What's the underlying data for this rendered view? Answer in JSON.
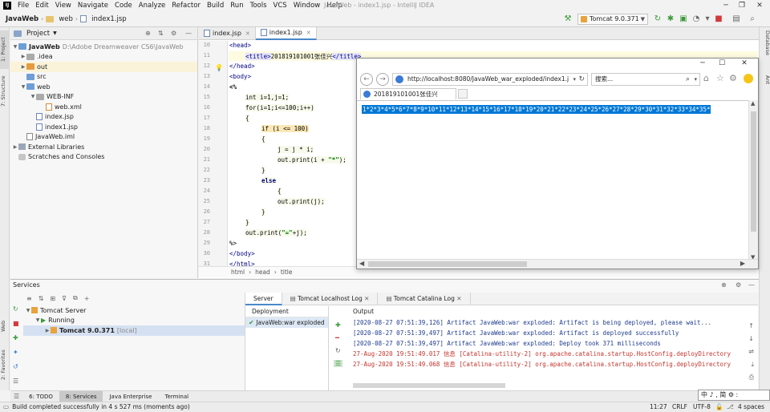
{
  "menubar": {
    "items": [
      "File",
      "Edit",
      "View",
      "Navigate",
      "Code",
      "Analyze",
      "Refactor",
      "Build",
      "Run",
      "Tools",
      "VCS",
      "Window",
      "Help"
    ],
    "window_title": "JavaWeb - index1.jsp - IntelliJ IDEA"
  },
  "navbar": {
    "crumbs": [
      "JavaWeb",
      "web",
      "index1.jsp"
    ],
    "run_config": "Tomcat 9.0.371"
  },
  "left_stripe": {
    "project": "1: Project",
    "structure": "7: Structure",
    "web": "Web",
    "favorites": "2: Favorites"
  },
  "right_stripe": {
    "database": "Database",
    "ant": "Ant"
  },
  "project": {
    "title": "Project",
    "tree": [
      {
        "label": "JavaWeb",
        "path": "D:\\Adobe Dreamweaver CS6\\JavaWeb"
      },
      {
        "label": ".idea"
      },
      {
        "label": "out"
      },
      {
        "label": "src"
      },
      {
        "label": "web"
      },
      {
        "label": "WEB-INF"
      },
      {
        "label": "web.xml"
      },
      {
        "label": "index.jsp"
      },
      {
        "label": "index1.jsp"
      },
      {
        "label": "JavaWeb.iml"
      },
      {
        "label": "External Libraries"
      },
      {
        "label": "Scratches and Consoles"
      }
    ]
  },
  "editor": {
    "tabs": [
      "index.jsp",
      "index1.jsp"
    ],
    "line_numbers": [
      "10",
      "11",
      "12",
      "13",
      "14",
      "15",
      "16",
      "17",
      "18",
      "19",
      "20",
      "21",
      "22",
      "23",
      "24",
      "25",
      "26",
      "27",
      "28",
      "29",
      "30",
      "31"
    ],
    "breadcrumb": [
      "html",
      "head",
      "title"
    ],
    "code": {
      "l10": "<head>",
      "l11_title_open": "<title>",
      "l11_title_text": "201819101001张佳兴",
      "l11_title_close": "</title>",
      "l12": "</head>",
      "l13": "<body>",
      "l14": "<%",
      "l15": "int i=1,j=1;",
      "l16": "for(i=1;i<=100;i++)",
      "l17": "{",
      "l18": "if (i <= 100)",
      "l19": "{",
      "l20": "j = j * i;",
      "l21a": "out.print(i + ",
      "l21b": "\"*\"",
      "l21c": ");",
      "l22": "}",
      "l23": "else",
      "l24": "{",
      "l25": "out.print(j);",
      "l26": "}",
      "l27": "}",
      "l28a": "out.print(",
      "l28b": "\"=\"",
      "l28c": "+j);",
      "l29": "%>",
      "l30": "</body>",
      "l31": "</html>"
    }
  },
  "browser": {
    "url": "http://localhost:8080/JavaWeb_war_exploded/index1.j",
    "search_placeholder": "搜索...",
    "tab_title": "201819101001张佳兴",
    "output": "1*2*3*4*5*6*7*8*9*10*11*12*13*14*15*16*17*18*19*20*21*22*23*24*25*26*27*28*29*30*31*32*33*34*35*"
  },
  "services": {
    "title": "Services",
    "tree": [
      {
        "label": "Tomcat Server"
      },
      {
        "label": "Running"
      },
      {
        "label": "Tomcat 9.0.371",
        "suffix": "[local]"
      }
    ],
    "tabs": [
      "Server",
      "Tomcat Localhost Log",
      "Tomcat Catalina Log"
    ],
    "deployment_header": "Deployment",
    "deployment_item": "JavaWeb:war exploded",
    "output_header": "Output",
    "log": [
      {
        "text": "[2020-08-27 07:51:39,126] Artifact JavaWeb:war exploded: Artifact is being deployed, please wait...",
        "kind": "info"
      },
      {
        "text": "[2020-08-27 07:51:39,497] Artifact JavaWeb:war exploded: Artifact is deployed successfully",
        "kind": "info"
      },
      {
        "text": "[2020-08-27 07:51:39,497] Artifact JavaWeb:war exploded: Deploy took 371 milliseconds",
        "kind": "info"
      },
      {
        "text": "27-Aug-2020 19:51:49.017 信息 [Catalina-utility-2] org.apache.catalina.startup.HostConfig.deployDirectory",
        "kind": "err"
      },
      {
        "text": "27-Aug-2020 19:51:49.068 信息 [Catalina-utility-2] org.apache.catalina.startup.HostConfig.deployDirectory",
        "kind": "err"
      }
    ]
  },
  "bottom_tabs": [
    "6: TODO",
    "8: Services",
    "Java Enterprise",
    "Terminal"
  ],
  "status": {
    "message": "Build completed successfully in 4 s 527 ms (moments ago)",
    "position": "11:27",
    "line_sep": "CRLF",
    "encoding": "UTF-8",
    "indent": "4 spaces"
  },
  "ime": "中 ♪ , 简 ⚙ :"
}
